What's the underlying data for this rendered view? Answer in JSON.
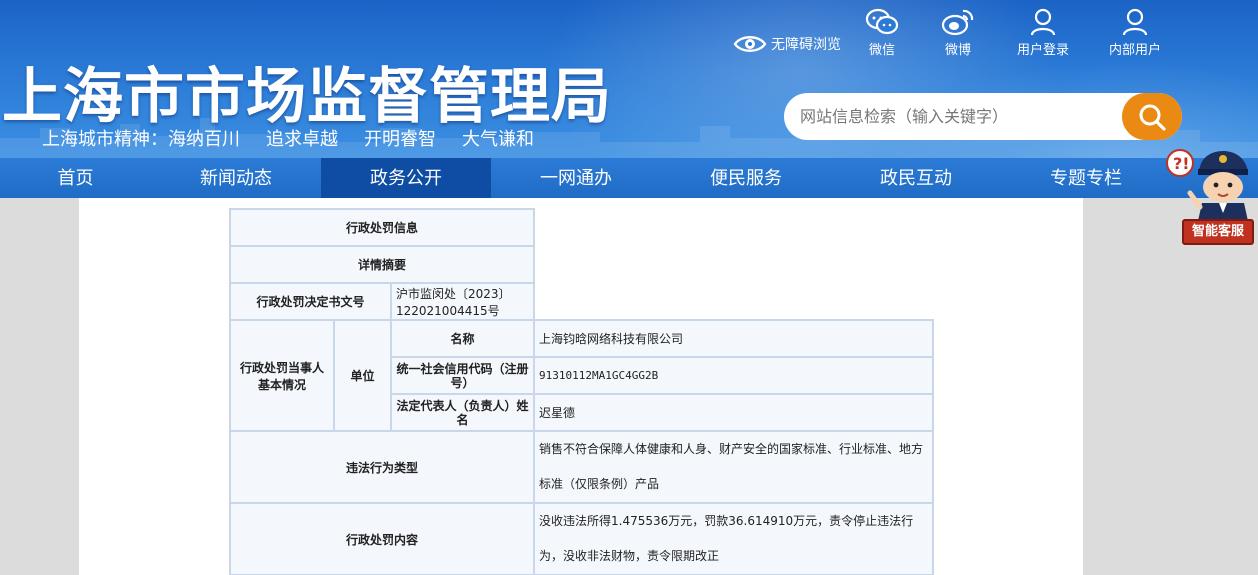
{
  "header": {
    "title": "上海市市场监督管理局",
    "slogan": [
      "上海城市精神：海纳百川",
      "追求卓越",
      "开明睿智",
      "大气谦和"
    ],
    "accessibility": "无障碍浏览",
    "links": [
      {
        "label": "微信",
        "icon": "wechat-icon"
      },
      {
        "label": "微博",
        "icon": "weibo-icon"
      },
      {
        "label": "用户登录",
        "icon": "user-icon"
      },
      {
        "label": "内部用户",
        "icon": "user-icon"
      }
    ],
    "search": {
      "placeholder": "网站信息检索（输入关键字）",
      "icon": "search-icon"
    }
  },
  "nav": {
    "items": [
      "首页",
      "新闻动态",
      "政务公开",
      "一网通办",
      "便民服务",
      "政民互动",
      "专题专栏"
    ],
    "active": "政务公开"
  },
  "assistant": {
    "label": "智能客服"
  },
  "table": {
    "title": "行政处罚信息",
    "subtitle": "详情摘要",
    "doc_no_label": "行政处罚决定书文号",
    "doc_no": "沪市监闵处〔2023〕122021004415号",
    "party_label": "行政处罚当事人基本情况",
    "unit_label": "单位",
    "name_label": "名称",
    "name": "上海钧晗网络科技有限公司",
    "credit_label": "统一社会信用代码（注册号）",
    "credit": "91310112MA1GC4GG2B",
    "rep_label": "法定代表人（负责人）姓名",
    "rep": "迟星德",
    "violation_label": "违法行为类型",
    "violation": "销售不符合保障人体健康和人身、财产安全的国家标准、行业标准、地方标准（仅限条例）产品",
    "penalty_label": "行政处罚内容",
    "penalty": "没收违法所得1.475536万元，罚款36.614910万元，责令停止违法行为，没收非法财物，责令限期改正"
  },
  "colors": {
    "header": "#1b63c6",
    "nav": "#2c7bd6",
    "nav_active": "#0e4da3",
    "search_btn": "#ea8a12",
    "assistant_sign": "#c0321f"
  }
}
